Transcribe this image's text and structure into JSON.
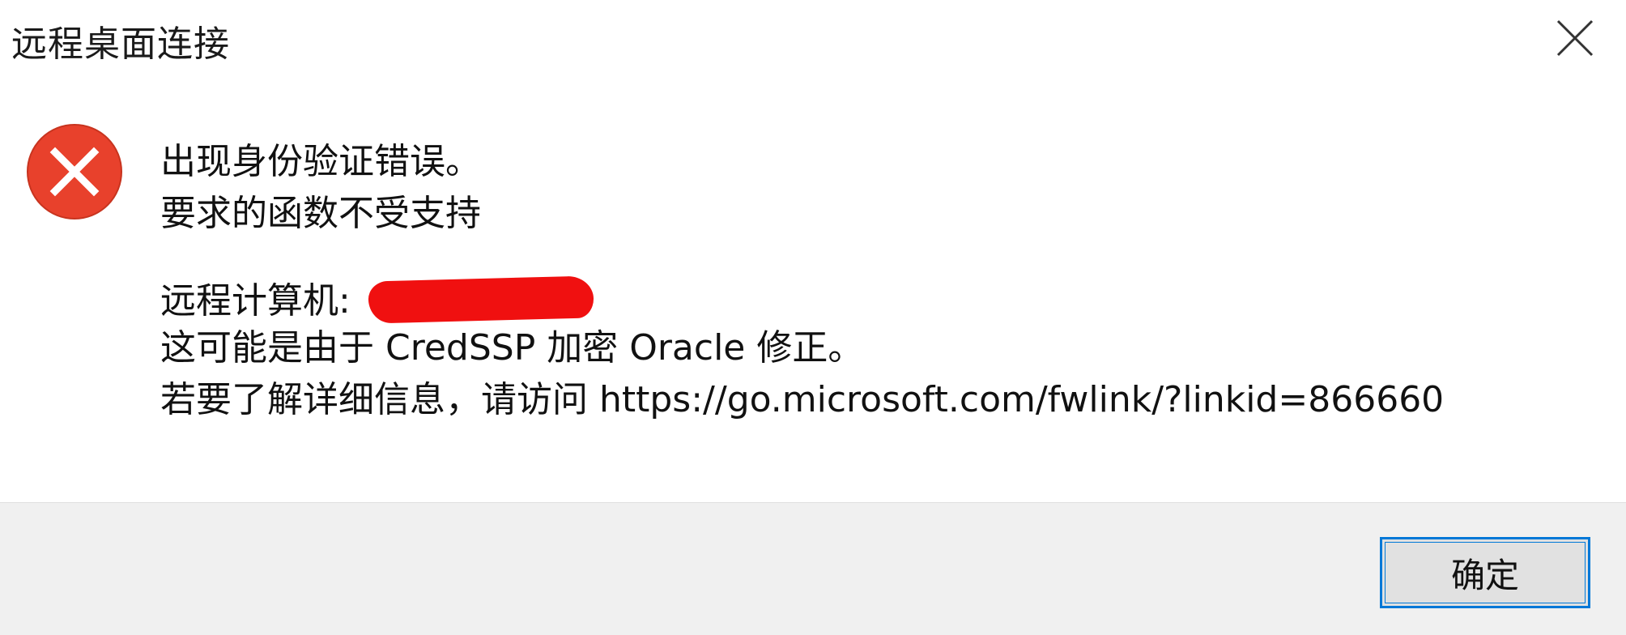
{
  "window": {
    "title": "远程桌面连接",
    "close_icon": "close-icon"
  },
  "message": {
    "icon": "error-icon",
    "line1": "出现身份验证错误。",
    "line2": "要求的函数不受支持",
    "remote_label": "远程计算机: ",
    "line4": "这可能是由于 CredSSP 加密 Oracle 修正。",
    "line5": "若要了解详细信息，请访问 https://go.microsoft.com/fwlink/?linkid=866660"
  },
  "footer": {
    "ok_label": "确定"
  },
  "colors": {
    "error_red": "#e8412c",
    "accent_blue": "#0078d7",
    "footer_bg": "#f0f0f0",
    "redaction_red": "#f01010"
  }
}
